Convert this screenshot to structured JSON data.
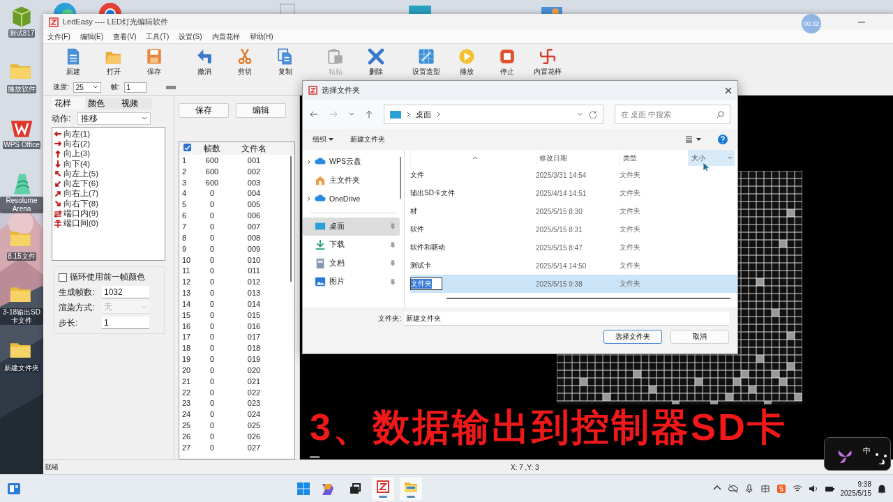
{
  "desktop": {
    "icons": [
      {
        "label": "测试817",
        "kind": "cube"
      },
      {
        "label": "播放软件",
        "kind": "folder"
      },
      {
        "label": "WPS Office",
        "kind": "wps"
      },
      {
        "label": "Resolume Arena",
        "kind": "resolume"
      },
      {
        "label": "8.15文件",
        "kind": "folder"
      },
      {
        "label": "3-18输出SD卡文件",
        "kind": "folder"
      },
      {
        "label": "新建文件夹",
        "kind": "folder"
      }
    ]
  },
  "recording_timer": "00:32",
  "window": {
    "title": "LedEasy ---- LED灯光编辑软件"
  },
  "menu": [
    "文件(F)",
    "编辑(E)",
    "查看(V)",
    "工具(T)",
    "设置(S)",
    "内置花样",
    "帮助(H)"
  ],
  "toolbar": [
    {
      "label": "新建",
      "kind": "new",
      "disabled": false
    },
    {
      "label": "打开",
      "kind": "open",
      "disabled": false
    },
    {
      "label": "保存",
      "kind": "save",
      "disabled": false
    },
    {
      "label": "撤消",
      "kind": "undo",
      "disabled": false
    },
    {
      "label": "剪切",
      "kind": "cut",
      "disabled": false
    },
    {
      "label": "复制",
      "kind": "copy",
      "disabled": false
    },
    {
      "label": "粘贴",
      "kind": "paste",
      "disabled": true
    },
    {
      "label": "删除",
      "kind": "delete",
      "disabled": false
    },
    {
      "label": "设置造型",
      "kind": "shape",
      "disabled": false
    },
    {
      "label": "播放",
      "kind": "play",
      "disabled": false
    },
    {
      "label": "停止",
      "kind": "stop",
      "disabled": false
    },
    {
      "label": "内置花样",
      "kind": "pattern",
      "disabled": false
    }
  ],
  "speed": {
    "label": "速度:",
    "value": "25"
  },
  "frame": {
    "label": "帧:",
    "value": "1"
  },
  "pattern_panel": {
    "tabs": [
      {
        "label": "花样",
        "selected": true
      },
      {
        "label": "颜色",
        "selected": false
      },
      {
        "label": "视频",
        "selected": false
      }
    ],
    "action_label": "动作:",
    "action_value": "推移",
    "effects": [
      {
        "label": "向左(1)",
        "kind": "left"
      },
      {
        "label": "向右(2)",
        "kind": "right"
      },
      {
        "label": "向上(3)",
        "kind": "up"
      },
      {
        "label": "向下(4)",
        "kind": "down"
      },
      {
        "label": "向左上(5)",
        "kind": "upleft"
      },
      {
        "label": "向左下(6)",
        "kind": "downleft"
      },
      {
        "label": "向右上(7)",
        "kind": "upright"
      },
      {
        "label": "向右下(8)",
        "kind": "downright"
      },
      {
        "label": "端口内(9)",
        "kind": "inner"
      },
      {
        "label": "端口间(0)",
        "kind": "between"
      }
    ],
    "loop_label": "循环使用前一帧颜色",
    "loop_checked": false,
    "fields": [
      {
        "label": "生成帧数:",
        "value": "1032",
        "kind": "input",
        "disabled": false
      },
      {
        "label": "渲染方式:",
        "value": "无",
        "kind": "select",
        "disabled": true
      },
      {
        "label": "步长:",
        "value": "1",
        "kind": "input",
        "disabled": false
      }
    ]
  },
  "frames_panel": {
    "buttons": [
      "保存",
      "编辑"
    ],
    "columns": [
      {
        "kind": "check",
        "checked": true
      },
      {
        "kind": "text",
        "label": "帧数"
      },
      {
        "kind": "text",
        "label": "文件名"
      }
    ],
    "rows": [
      [
        "1",
        "600",
        "001"
      ],
      [
        "2",
        "600",
        "002"
      ],
      [
        "3",
        "600",
        "003"
      ],
      [
        "4",
        "0",
        "004"
      ],
      [
        "5",
        "0",
        "005"
      ],
      [
        "6",
        "0",
        "006"
      ],
      [
        "7",
        "0",
        "007"
      ],
      [
        "8",
        "0",
        "008"
      ],
      [
        "9",
        "0",
        "009"
      ],
      [
        "10",
        "0",
        "010"
      ],
      [
        "11",
        "0",
        "011"
      ],
      [
        "12",
        "0",
        "012"
      ],
      [
        "13",
        "0",
        "013"
      ],
      [
        "14",
        "0",
        "014"
      ],
      [
        "15",
        "0",
        "015"
      ],
      [
        "16",
        "0",
        "016"
      ],
      [
        "17",
        "0",
        "017"
      ],
      [
        "18",
        "0",
        "018"
      ],
      [
        "19",
        "0",
        "019"
      ],
      [
        "20",
        "0",
        "020"
      ],
      [
        "21",
        "0",
        "021"
      ],
      [
        "22",
        "0",
        "022"
      ],
      [
        "23",
        "0",
        "023"
      ],
      [
        "24",
        "0",
        "024"
      ],
      [
        "25",
        "0",
        "025"
      ],
      [
        "26",
        "0",
        "026"
      ],
      [
        "27",
        "0",
        "027"
      ]
    ]
  },
  "canvas": {
    "caption": "3、数据输出到控制器SD卡"
  },
  "status_bar": {
    "text": "就绪",
    "coords": "X: 7 ,Y: 3"
  },
  "dialog": {
    "title": "选择文件夹",
    "path": "桌面",
    "search_placeholder": "在 桌面 中搜索",
    "toolbar": {
      "organize": "组织",
      "new_folder": "新建文件夹"
    },
    "nav": [
      {
        "label": "WPS云盘",
        "kind": "cloud",
        "expandable": true,
        "pinned": false,
        "selected": false
      },
      {
        "label": "主文件夹",
        "kind": "home",
        "expandable": false,
        "pinned": false,
        "selected": false
      },
      {
        "label": "OneDrive",
        "kind": "cloud",
        "expandable": true,
        "pinned": false,
        "selected": false
      },
      {
        "label": "桌面",
        "kind": "desktop",
        "expandable": false,
        "pinned": true,
        "selected": true
      },
      {
        "label": "下载",
        "kind": "download",
        "expandable": false,
        "pinned": true,
        "selected": false
      },
      {
        "label": "文档",
        "kind": "document",
        "expandable": false,
        "pinned": true,
        "selected": false
      },
      {
        "label": "图片",
        "kind": "picture",
        "expandable": false,
        "pinned": true,
        "selected": false
      }
    ],
    "columns": [
      {
        "label": "修改日期",
        "hovered": false
      },
      {
        "label": "类型",
        "hovered": false
      },
      {
        "label": "大小",
        "hovered": true
      }
    ],
    "files": [
      {
        "name": "文件",
        "date": "2025/3/31 14:54",
        "type": "文件夹",
        "selected": false
      },
      {
        "name": "辅出SD卡文件",
        "date": "2025/4/14 14:51",
        "type": "文件夹",
        "selected": false
      },
      {
        "name": "材",
        "date": "2025/5/15 8:30",
        "type": "文件夹",
        "selected": false
      },
      {
        "name": "软件",
        "date": "2025/5/15 8:31",
        "type": "文件夹",
        "selected": false
      },
      {
        "name": "软件和驱动",
        "date": "2025/5/15 8:47",
        "type": "文件夹",
        "selected": false
      },
      {
        "name": "测试卡",
        "date": "2025/5/14 14:50",
        "type": "文件夹",
        "selected": false
      },
      {
        "name": "文件夹",
        "date": "2025/5/15 9:38",
        "type": "文件夹",
        "selected": true
      }
    ],
    "folder_label": "文件夹:",
    "folder_value": "新建文件夹",
    "buttons": [
      {
        "label": "选择文件夹",
        "primary": true
      },
      {
        "label": "取消",
        "primary": false
      }
    ]
  },
  "ime": {
    "label": "中"
  },
  "taskbar": {
    "apps": [
      {
        "kind": "copilot",
        "running": false
      },
      {
        "kind": "taskview",
        "running": false
      },
      {
        "kind": "ledeasy",
        "running": true
      },
      {
        "kind": "explorer",
        "running": true
      }
    ],
    "time": "9:38",
    "date": "2025/5/15"
  }
}
